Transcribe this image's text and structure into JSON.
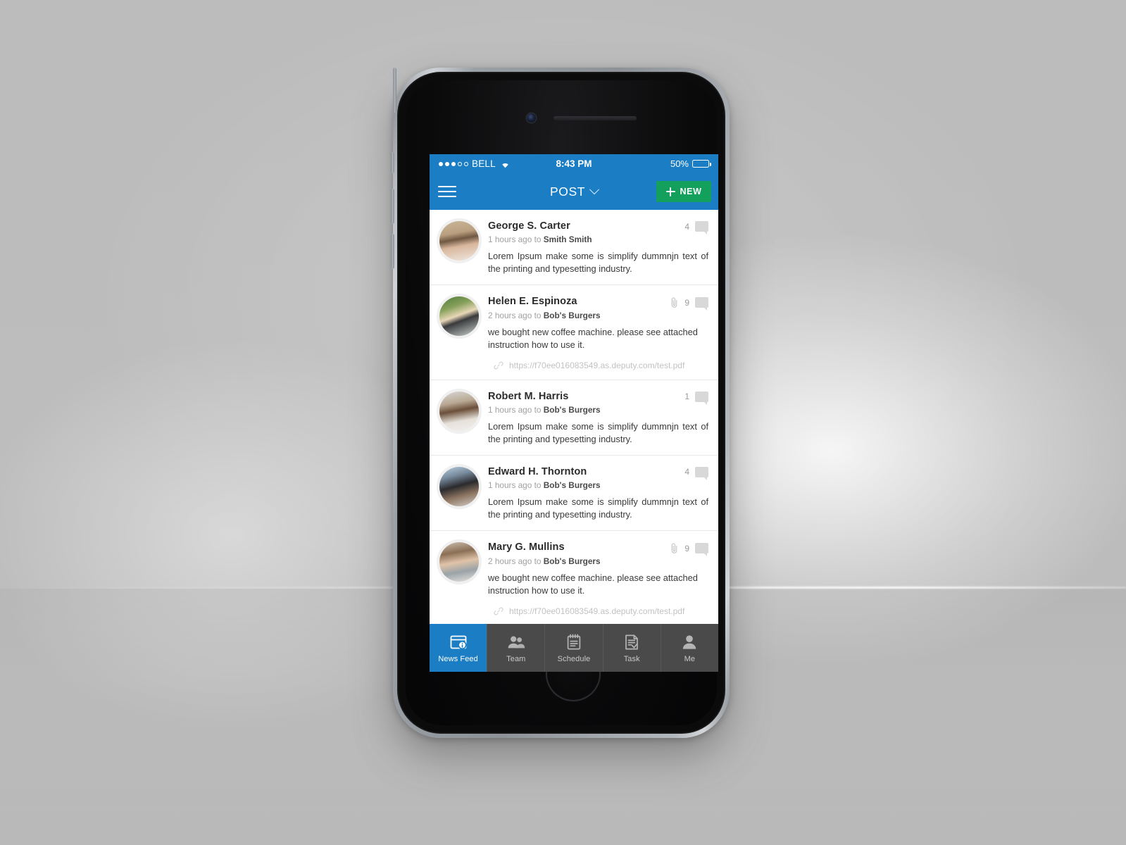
{
  "device": {
    "name": "smartphone-mockup"
  },
  "status_bar": {
    "signal_filled": 3,
    "signal_empty": 2,
    "carrier": "BELL",
    "wifi_icon": "wifi-icon",
    "time": "8:43 PM",
    "battery_label": "50%",
    "battery_percent": 50
  },
  "nav_bar": {
    "menu_icon": "hamburger-menu-icon",
    "title": "POST",
    "dropdown_icon": "chevron-down-icon",
    "new_button_label": "NEW",
    "new_button_icon": "plus-icon",
    "accent_color": "#1b7ec4",
    "new_button_color": "#13a05c"
  },
  "feed": {
    "posts": [
      {
        "author": "George S. Carter",
        "time": "1 hours ago",
        "to_label": "to",
        "target": "Smith Smith",
        "text": "Lorem Ipsum make some is simplify dummnjn text of the printing and typesetting industry.",
        "comment_count": "4",
        "has_attachment": false,
        "attachment_url": "",
        "avatar_name": "avatar-george-s-carter"
      },
      {
        "author": "Helen E. Espinoza",
        "time": "2 hours ago",
        "to_label": "to",
        "target": "Bob's Burgers",
        "text": "we bought new coffee machine. please see attached instruction how to use it.",
        "comment_count": "9",
        "has_attachment": true,
        "attachment_url": "https://f70ee016083549.as.deputy.com/test.pdf",
        "avatar_name": "avatar-helen-e-espinoza"
      },
      {
        "author": "Robert M. Harris",
        "time": "1 hours ago",
        "to_label": "to",
        "target": "Bob's Burgers",
        "text": "Lorem Ipsum make some is simplify dummnjn text of the printing and typesetting industry.",
        "comment_count": "1",
        "has_attachment": false,
        "attachment_url": "",
        "avatar_name": "avatar-robert-m-harris"
      },
      {
        "author": "Edward H. Thornton",
        "time": "1 hours ago",
        "to_label": "to",
        "target": "Bob's Burgers",
        "text": "Lorem Ipsum make some is simplify dummnjn text of the printing and typesetting industry.",
        "comment_count": "4",
        "has_attachment": false,
        "attachment_url": "",
        "avatar_name": "avatar-edward-h-thornton"
      },
      {
        "author": "Mary G. Mullins",
        "time": "2 hours ago",
        "to_label": "to",
        "target": "Bob's Burgers",
        "text": "we bought new coffee machine. please see attached instruction how to use it.",
        "comment_count": "9",
        "has_attachment": true,
        "attachment_url": "https://f70ee016083549.as.deputy.com/test.pdf",
        "avatar_name": "avatar-mary-g-mullins"
      }
    ]
  },
  "tab_bar": {
    "active_index": 0,
    "active_color": "#1b7ec4",
    "background_color": "#4a4a4a",
    "tabs": [
      {
        "label": "News Feed",
        "icon": "news-feed-icon"
      },
      {
        "label": "Team",
        "icon": "team-icon"
      },
      {
        "label": "Schedule",
        "icon": "schedule-icon"
      },
      {
        "label": "Task",
        "icon": "task-icon"
      },
      {
        "label": "Me",
        "icon": "person-icon"
      }
    ]
  }
}
